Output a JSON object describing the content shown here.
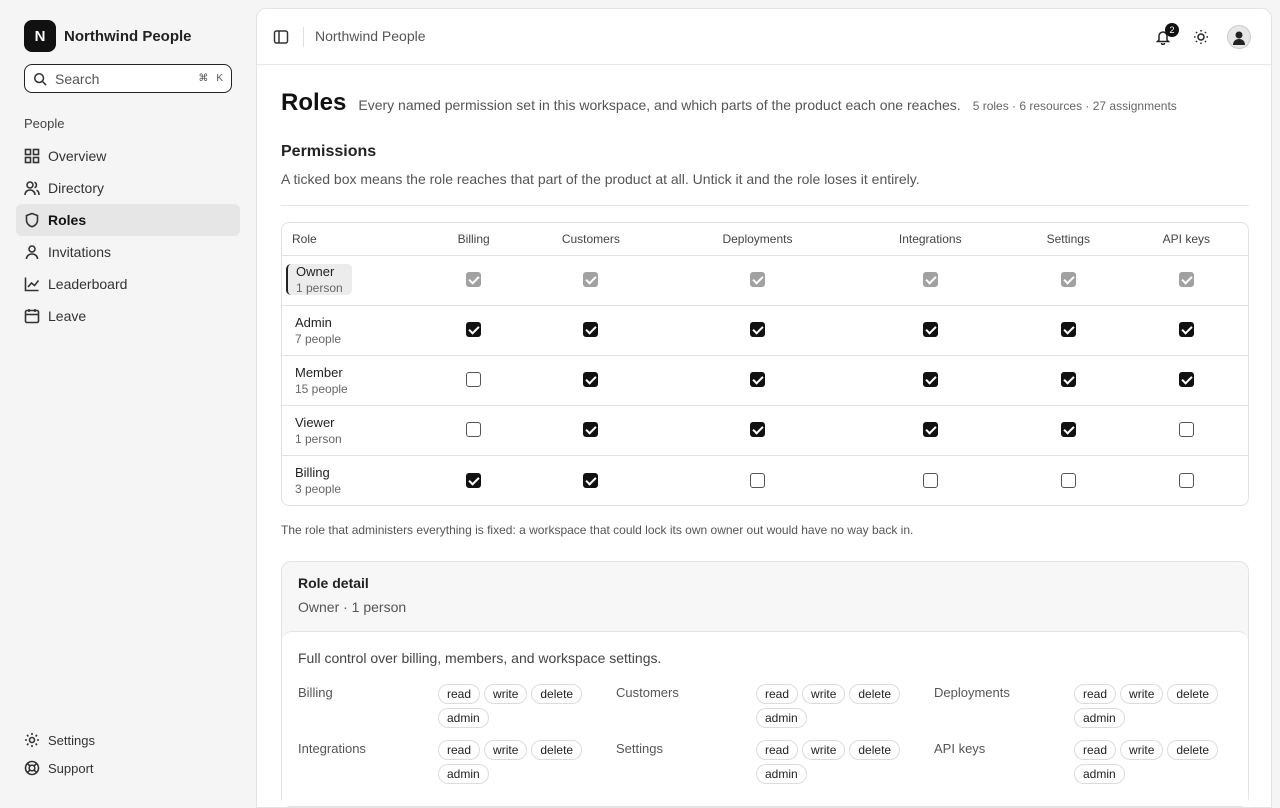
{
  "brand": {
    "logo_letter": "N",
    "name": "Northwind People"
  },
  "search": {
    "placeholder": "Search",
    "shortcut_mod": "⌘",
    "shortcut_key": "K"
  },
  "sidebar": {
    "section_label": "People",
    "items": [
      {
        "label": "Overview",
        "icon": "grid-icon"
      },
      {
        "label": "Directory",
        "icon": "users-icon"
      },
      {
        "label": "Roles",
        "icon": "shield-icon",
        "active": true
      },
      {
        "label": "Invitations",
        "icon": "user-icon"
      },
      {
        "label": "Leaderboard",
        "icon": "chart-icon"
      },
      {
        "label": "Leave",
        "icon": "calendar-icon"
      }
    ],
    "bottom_items": [
      {
        "label": "Settings",
        "icon": "gear-icon"
      },
      {
        "label": "Support",
        "icon": "lifebuoy-icon"
      }
    ]
  },
  "topbar": {
    "breadcrumb": "Northwind People",
    "notification_count": "2"
  },
  "page": {
    "title": "Roles",
    "subtitle": "Every named permission set in this workspace, and which parts of the product each one reaches.",
    "stats": "5 roles · 6 resources · 27 assignments"
  },
  "permissions": {
    "title": "Permissions",
    "description": "A ticked box means the role reaches that part of the product at all. Untick it and the role loses it entirely.",
    "role_header": "Role",
    "columns": [
      "Billing",
      "Customers",
      "Deployments",
      "Integrations",
      "Settings",
      "API keys"
    ],
    "rows": [
      {
        "name": "Owner",
        "count": "1 person",
        "locked": true,
        "checks": [
          true,
          true,
          true,
          true,
          true,
          true
        ]
      },
      {
        "name": "Admin",
        "count": "7 people",
        "checks": [
          true,
          true,
          true,
          true,
          true,
          true
        ]
      },
      {
        "name": "Member",
        "count": "15 people",
        "checks": [
          false,
          true,
          true,
          true,
          true,
          true
        ]
      },
      {
        "name": "Viewer",
        "count": "1 person",
        "checks": [
          false,
          true,
          true,
          true,
          true,
          false
        ]
      },
      {
        "name": "Billing",
        "count": "3 people",
        "checks": [
          true,
          true,
          false,
          false,
          false,
          false
        ]
      }
    ],
    "note": "The role that administers everything is fixed: a workspace that could lock its own owner out would have no way back in."
  },
  "role_detail": {
    "title": "Role detail",
    "subtitle": "Owner · 1 person",
    "description": "Full control over billing, members, and workspace settings.",
    "resources": [
      {
        "name": "Billing",
        "actions": [
          "read",
          "write",
          "delete",
          "admin"
        ]
      },
      {
        "name": "Customers",
        "actions": [
          "read",
          "write",
          "delete",
          "admin"
        ]
      },
      {
        "name": "Deployments",
        "actions": [
          "read",
          "write",
          "delete",
          "admin"
        ]
      },
      {
        "name": "Integrations",
        "actions": [
          "read",
          "write",
          "delete",
          "admin"
        ]
      },
      {
        "name": "Settings",
        "actions": [
          "read",
          "write",
          "delete",
          "admin"
        ]
      },
      {
        "name": "API keys",
        "actions": [
          "read",
          "write",
          "delete",
          "admin"
        ]
      }
    ]
  }
}
